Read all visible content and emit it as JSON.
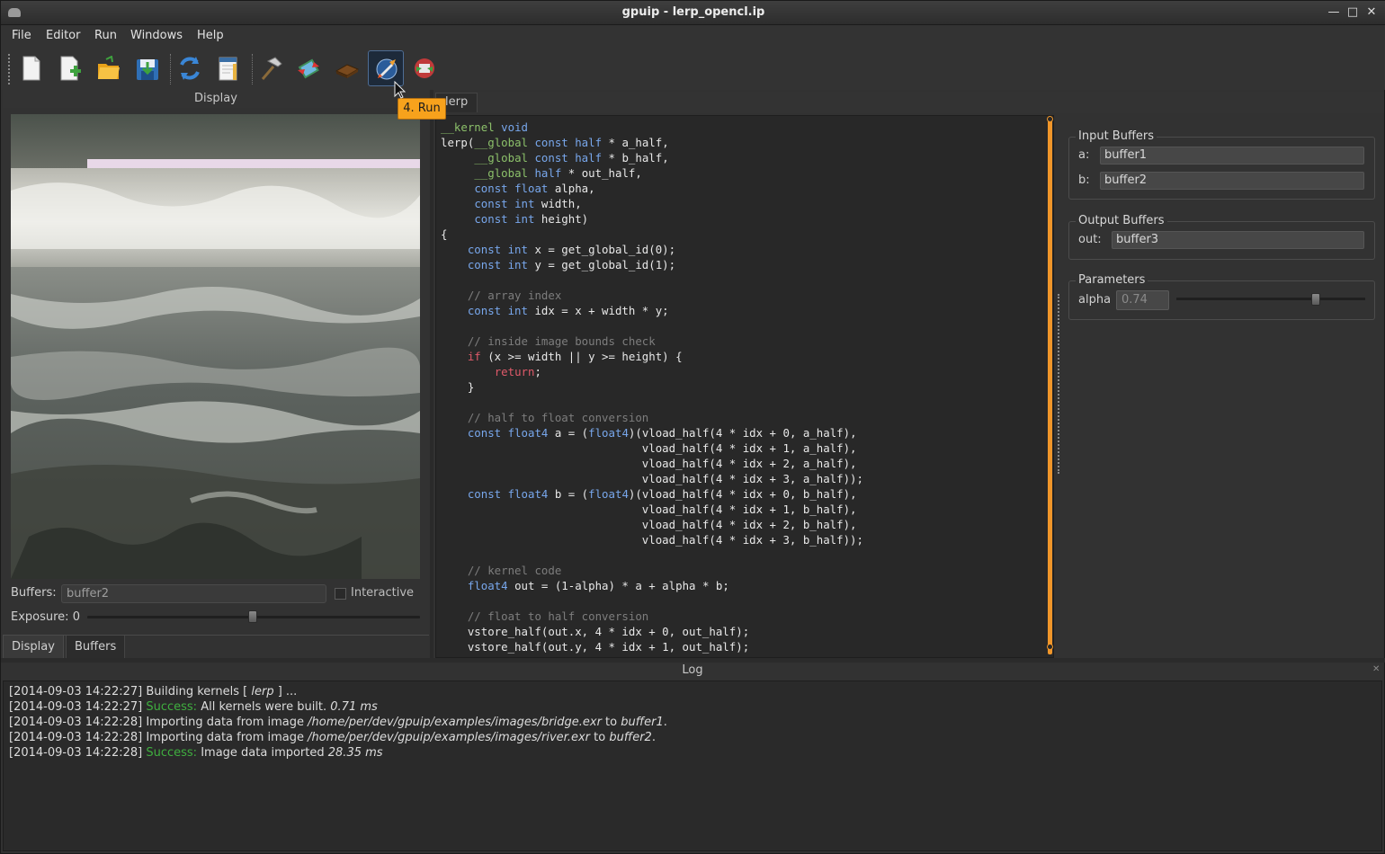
{
  "window": {
    "title": "gpuip - lerp_opencl.ip"
  },
  "menu": [
    "File",
    "Editor",
    "Run",
    "Windows",
    "Help"
  ],
  "toolbar": {
    "icons": [
      "new-file-icon",
      "add-file-icon",
      "open-folder-icon",
      "save-icon",
      "refresh-icon",
      "notes-icon",
      "build-hammer-icon",
      "import-images-icon",
      "chip-icon",
      "run-icon",
      "export-icon"
    ],
    "tooltip": "4. Run"
  },
  "display_panel": {
    "header": "Display",
    "buffers_label": "Buffers:",
    "buffer_value": "buffer2",
    "interactive_label": "Interactive",
    "exposure_label": "Exposure: 0",
    "tabs": [
      "Display",
      "Buffers"
    ]
  },
  "editor": {
    "tab": "lerp",
    "lines": [
      [
        [
          "g",
          "__kernel"
        ],
        [
          "",
          ""
        ],
        [
          "k",
          " void"
        ]
      ],
      [
        [
          "",
          "lerp("
        ],
        [
          "g",
          "__global"
        ],
        [
          "k",
          " const half"
        ],
        [
          "",
          " * a_half,"
        ]
      ],
      [
        [
          "",
          "     "
        ],
        [
          "g",
          "__global"
        ],
        [
          "k",
          " const half"
        ],
        [
          "",
          " * b_half,"
        ]
      ],
      [
        [
          "",
          "     "
        ],
        [
          "g",
          "__global"
        ],
        [
          "k",
          " half"
        ],
        [
          "",
          " * out_half,"
        ]
      ],
      [
        [
          "",
          "     "
        ],
        [
          "k",
          "const float"
        ],
        [
          "",
          " alpha,"
        ]
      ],
      [
        [
          "",
          "     "
        ],
        [
          "k",
          "const int"
        ],
        [
          "",
          " width,"
        ]
      ],
      [
        [
          "",
          "     "
        ],
        [
          "k",
          "const int"
        ],
        [
          "",
          " height)"
        ]
      ],
      [
        [
          "",
          "{"
        ]
      ],
      [
        [
          "",
          "    "
        ],
        [
          "k",
          "const int"
        ],
        [
          "",
          " x = get_global_id(0);"
        ]
      ],
      [
        [
          "",
          "    "
        ],
        [
          "k",
          "const int"
        ],
        [
          "",
          " y = get_global_id(1);"
        ]
      ],
      [
        [
          "",
          ""
        ]
      ],
      [
        [
          "",
          "    "
        ],
        [
          "c",
          "// array index"
        ]
      ],
      [
        [
          "",
          "    "
        ],
        [
          "k",
          "const int"
        ],
        [
          "",
          " idx = x + width * y;"
        ]
      ],
      [
        [
          "",
          ""
        ]
      ],
      [
        [
          "",
          "    "
        ],
        [
          "c",
          "// inside image bounds check"
        ]
      ],
      [
        [
          "",
          "    "
        ],
        [
          "r",
          "if"
        ],
        [
          "",
          " (x >= width || y >= height) {"
        ]
      ],
      [
        [
          "",
          "        "
        ],
        [
          "r",
          "return"
        ],
        [
          "",
          ";"
        ]
      ],
      [
        [
          "",
          "    }"
        ]
      ],
      [
        [
          "",
          ""
        ]
      ],
      [
        [
          "",
          "    "
        ],
        [
          "c",
          "// half to float conversion"
        ]
      ],
      [
        [
          "",
          "    "
        ],
        [
          "k",
          "const float4"
        ],
        [
          "",
          " a = ("
        ],
        [
          "k",
          "float4"
        ],
        [
          "",
          ")(vload_half(4 * idx + 0, a_half),"
        ]
      ],
      [
        [
          "",
          "                              vload_half(4 * idx + 1, a_half),"
        ]
      ],
      [
        [
          "",
          "                              vload_half(4 * idx + 2, a_half),"
        ]
      ],
      [
        [
          "",
          "                              vload_half(4 * idx + 3, a_half));"
        ]
      ],
      [
        [
          "",
          "    "
        ],
        [
          "k",
          "const float4"
        ],
        [
          "",
          " b = ("
        ],
        [
          "k",
          "float4"
        ],
        [
          "",
          ")(vload_half(4 * idx + 0, b_half),"
        ]
      ],
      [
        [
          "",
          "                              vload_half(4 * idx + 1, b_half),"
        ]
      ],
      [
        [
          "",
          "                              vload_half(4 * idx + 2, b_half),"
        ]
      ],
      [
        [
          "",
          "                              vload_half(4 * idx + 3, b_half));"
        ]
      ],
      [
        [
          "",
          ""
        ]
      ],
      [
        [
          "",
          "    "
        ],
        [
          "c",
          "// kernel code"
        ]
      ],
      [
        [
          "",
          "    "
        ],
        [
          "k",
          "float4"
        ],
        [
          "",
          " out = (1-alpha) * a + alpha * b;"
        ]
      ],
      [
        [
          "",
          ""
        ]
      ],
      [
        [
          "",
          "    "
        ],
        [
          "c",
          "// float to half conversion"
        ]
      ],
      [
        [
          "",
          "    vstore_half(out.x, 4 * idx + 0, out_half);"
        ]
      ],
      [
        [
          "",
          "    vstore_half(out.y, 4 * idx + 1, out_half);"
        ]
      ]
    ]
  },
  "right_panel": {
    "input_buffers": {
      "title": "Input Buffers",
      "a_label": "a:",
      "a_value": "buffer1",
      "b_label": "b:",
      "b_value": "buffer2"
    },
    "output_buffers": {
      "title": "Output Buffers",
      "out_label": "out:",
      "out_value": "buffer3"
    },
    "parameters": {
      "title": "Parameters",
      "alpha_label": "alpha",
      "alpha_value": "0.74",
      "alpha_level": 0.74
    }
  },
  "log": {
    "header": "Log",
    "lines": [
      [
        [
          "",
          "[2014-09-03 14:22:27] Building kernels [ "
        ],
        [
          "it",
          "lerp"
        ],
        [
          "",
          " ] ..."
        ]
      ],
      [
        [
          "",
          "[2014-09-03 14:22:27] "
        ],
        [
          "ok",
          "Success:"
        ],
        [
          "",
          " All kernels were built. "
        ],
        [
          "it",
          "0.71 ms"
        ]
      ],
      [
        [
          "",
          "[2014-09-03 14:22:28] Importing data from image "
        ],
        [
          "it",
          "/home/per/dev/gpuip/examples/images/bridge.exr"
        ],
        [
          "",
          " to "
        ],
        [
          "it",
          "buffer1"
        ],
        [
          "",
          "."
        ]
      ],
      [
        [
          "",
          "[2014-09-03 14:22:28] Importing data from image "
        ],
        [
          "it",
          "/home/per/dev/gpuip/examples/images/river.exr"
        ],
        [
          "",
          " to "
        ],
        [
          "it",
          "buffer2"
        ],
        [
          "",
          "."
        ]
      ],
      [
        [
          "",
          "[2014-09-03 14:22:28] "
        ],
        [
          "ok",
          "Success:"
        ],
        [
          "",
          " Image data imported "
        ],
        [
          "it",
          "28.35 ms"
        ]
      ]
    ]
  }
}
